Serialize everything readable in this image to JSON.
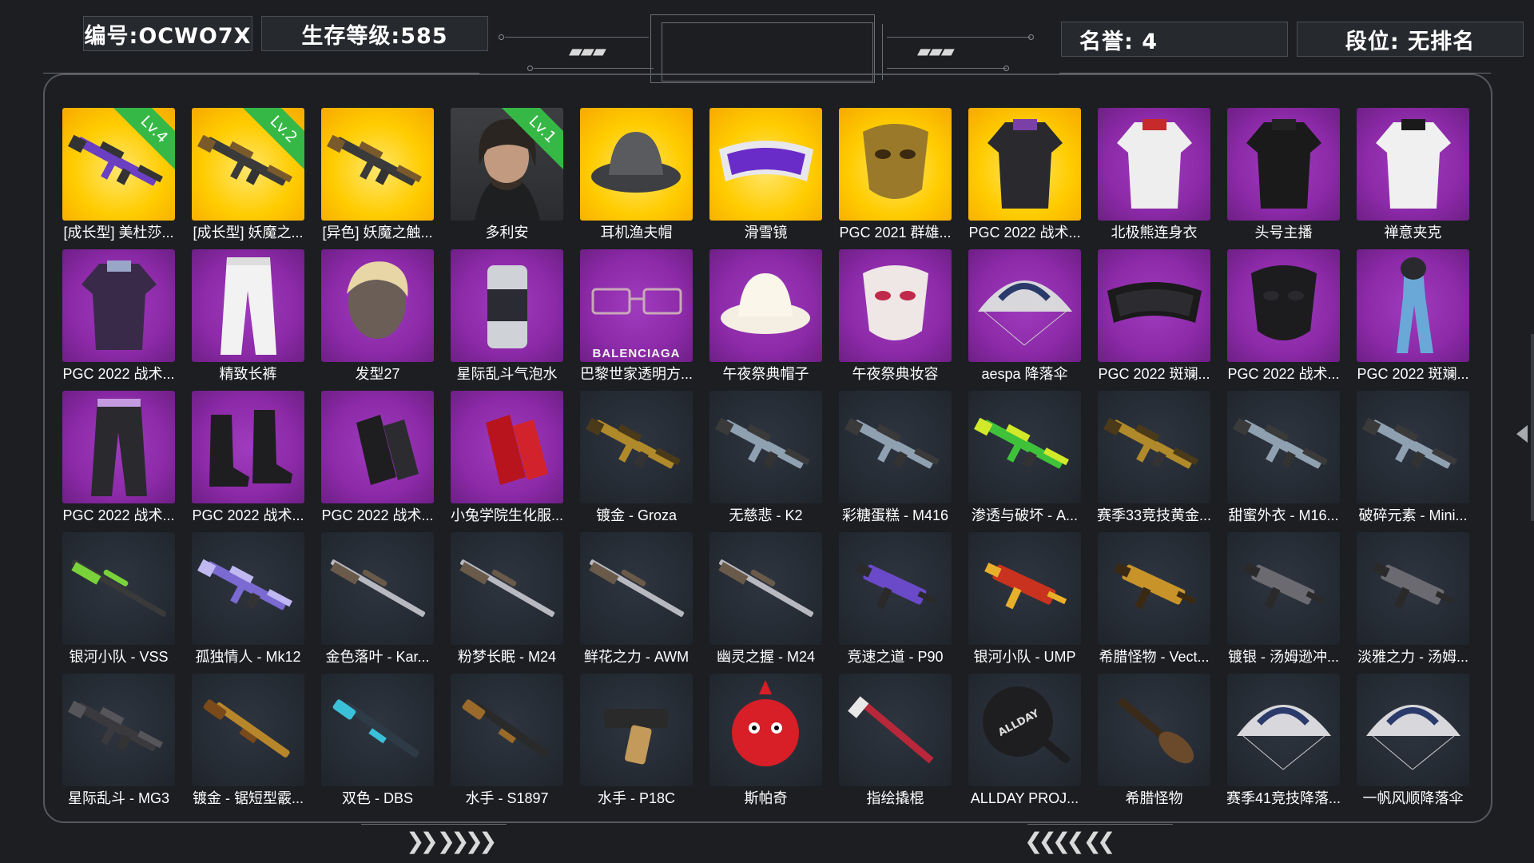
{
  "header": {
    "id_label": "编号:OCWO7X",
    "level_label": "生存等级:585",
    "honor_label": "名誉: 4",
    "rank_label": "段位: 无排名"
  },
  "items": [
    {
      "name": "[成长型] 美杜莎...",
      "bg": "yellow",
      "icon": "purple-assault-rifle-icon",
      "badge": "Lv.4"
    },
    {
      "name": "[成长型] 妖魔之...",
      "bg": "yellow",
      "icon": "assault-rifle-icon",
      "badge": "Lv.2"
    },
    {
      "name": "[异色] 妖魔之触...",
      "bg": "yellow",
      "icon": "assault-rifle-icon"
    },
    {
      "name": "多利安",
      "bg": "char",
      "icon": "character-portrait-icon",
      "badge": "Lv.1"
    },
    {
      "name": "耳机渔夫帽",
      "bg": "yellow",
      "icon": "bucket-hat-icon"
    },
    {
      "name": "滑雪镜",
      "bg": "yellow",
      "icon": "ski-goggles-icon"
    },
    {
      "name": "PGC 2021 群雄...",
      "bg": "yellow",
      "icon": "gold-mask-icon"
    },
    {
      "name": "PGC 2022 战术...",
      "bg": "yellow",
      "icon": "tactical-vest-icon"
    },
    {
      "name": "北极熊连身衣",
      "bg": "purple",
      "icon": "jumpsuit-icon"
    },
    {
      "name": "头号主播",
      "bg": "purple",
      "icon": "tshirt-icon"
    },
    {
      "name": "禅意夹克",
      "bg": "purple",
      "icon": "hooded-jacket-icon"
    },
    {
      "name": "PGC 2022 战术...",
      "bg": "purple",
      "icon": "coat-icon"
    },
    {
      "name": "精致长裤",
      "bg": "purple",
      "icon": "pants-icon"
    },
    {
      "name": "发型27",
      "bg": "purple",
      "icon": "hairstyle-icon"
    },
    {
      "name": "星际乱斗气泡水",
      "bg": "purple",
      "icon": "soda-can-icon"
    },
    {
      "name": "巴黎世家透明方...",
      "bg": "purple",
      "icon": "glasses-icon",
      "brand": "BALENCIAGA"
    },
    {
      "name": "午夜祭典帽子",
      "bg": "purple",
      "icon": "cowboy-hat-icon"
    },
    {
      "name": "午夜祭典妆容",
      "bg": "purple",
      "icon": "skull-makeup-icon"
    },
    {
      "name": "aespa 降落伞",
      "bg": "purple",
      "icon": "parachute-icon"
    },
    {
      "name": "PGC 2022 斑斓...",
      "bg": "purple",
      "icon": "goggles-icon"
    },
    {
      "name": "PGC 2022 战术...",
      "bg": "purple",
      "icon": "face-mask-icon"
    },
    {
      "name": "PGC 2022 斑斓...",
      "bg": "purple",
      "icon": "scarf-icon"
    },
    {
      "name": "PGC 2022 战术...",
      "bg": "purple",
      "icon": "tactical-pants-icon"
    },
    {
      "name": "PGC 2022 战术...",
      "bg": "purple",
      "icon": "boots-icon"
    },
    {
      "name": "PGC 2022 战术...",
      "bg": "purple",
      "icon": "gloves-icon"
    },
    {
      "name": "小兔学院生化服...",
      "bg": "purple",
      "icon": "red-gloves-icon"
    },
    {
      "name": "镀金 - Groza",
      "bg": "dark",
      "icon": "gold-rifle-icon"
    },
    {
      "name": "无慈悲 - K2",
      "bg": "dark",
      "icon": "rifle-icon"
    },
    {
      "name": "彩糖蛋糕 - M416",
      "bg": "dark",
      "icon": "rifle-icon"
    },
    {
      "name": "渗透与破坏 - A...",
      "bg": "dark",
      "icon": "green-rifle-icon"
    },
    {
      "name": "赛季33竞技黄金...",
      "bg": "dark",
      "icon": "gold-rifle-icon"
    },
    {
      "name": "甜蜜外衣 - M16...",
      "bg": "dark",
      "icon": "rifle-icon"
    },
    {
      "name": "破碎元素 - Mini...",
      "bg": "dark",
      "icon": "rifle-icon"
    },
    {
      "name": "银河小队 - VSS",
      "bg": "dark",
      "icon": "green-sniper-icon"
    },
    {
      "name": "孤独情人 - Mk12",
      "bg": "dark",
      "icon": "purple-rifle-icon"
    },
    {
      "name": "金色落叶 - Kar...",
      "bg": "dark",
      "icon": "sniper-rifle-icon"
    },
    {
      "name": "粉梦长眠 - M24",
      "bg": "dark",
      "icon": "sniper-rifle-icon"
    },
    {
      "name": "鲜花之力 - AWM",
      "bg": "dark",
      "icon": "sniper-rifle-icon"
    },
    {
      "name": "幽灵之握 - M24",
      "bg": "dark",
      "icon": "sniper-rifle-icon"
    },
    {
      "name": "竞速之道 - P90",
      "bg": "dark",
      "icon": "purple-smg-icon"
    },
    {
      "name": "银河小队 - UMP",
      "bg": "dark",
      "icon": "smg-icon"
    },
    {
      "name": "希腊怪物 - Vect...",
      "bg": "dark",
      "icon": "gold-smg-icon"
    },
    {
      "name": "镀银 - 汤姆逊冲...",
      "bg": "dark",
      "icon": "tommy-gun-icon"
    },
    {
      "name": "淡雅之力 - 汤姆...",
      "bg": "dark",
      "icon": "tommy-gun-icon"
    },
    {
      "name": "星际乱斗 - MG3",
      "bg": "dark",
      "icon": "machine-gun-icon"
    },
    {
      "name": "镀金 - 锯短型霰...",
      "bg": "dark",
      "icon": "sawed-off-shotgun-icon"
    },
    {
      "name": "双色 - DBS",
      "bg": "dark",
      "icon": "shotgun-icon"
    },
    {
      "name": "水手 - S1897",
      "bg": "dark",
      "icon": "pump-shotgun-icon"
    },
    {
      "name": "水手 - P18C",
      "bg": "dark",
      "icon": "pistol-icon"
    },
    {
      "name": "斯帕奇",
      "bg": "dark",
      "icon": "red-mascot-icon"
    },
    {
      "name": "指绘撬棍",
      "bg": "dark",
      "icon": "crowbar-icon"
    },
    {
      "name": "ALLDAY PROJ...",
      "bg": "dark",
      "icon": "frying-pan-icon"
    },
    {
      "name": "希腊怪物",
      "bg": "dark",
      "icon": "club-icon"
    },
    {
      "name": "赛季41竞技降落...",
      "bg": "dark",
      "icon": "parachute-icon"
    },
    {
      "name": "一帆风顺降落伞",
      "bg": "dark",
      "icon": "parachute-icon"
    }
  ]
}
